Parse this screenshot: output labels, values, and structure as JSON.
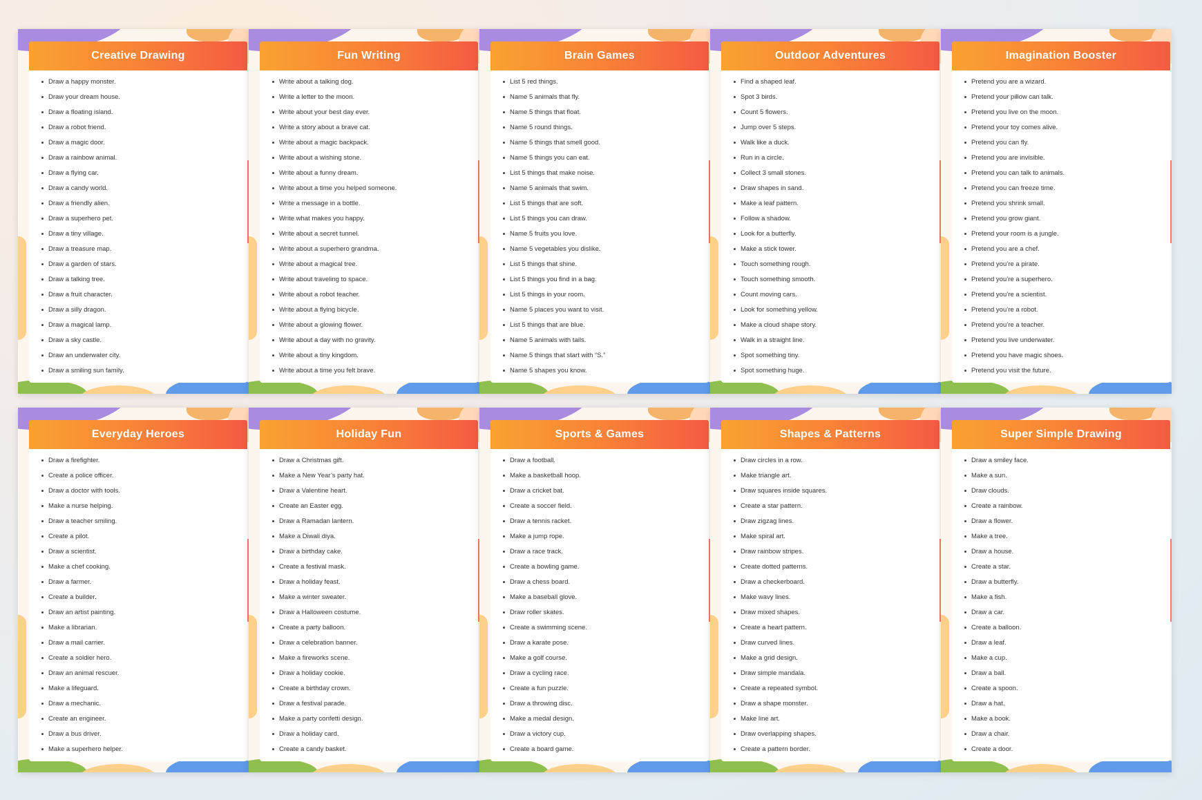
{
  "cards": [
    {
      "title": "Creative Drawing",
      "items": [
        "Draw a happy monster.",
        "Draw your dream house.",
        "Draw a floating island.",
        "Draw a robot friend.",
        "Draw a magic door.",
        "Draw a rainbow animal.",
        "Draw a flying car.",
        "Draw a candy world.",
        "Draw a friendly alien.",
        "Draw a superhero pet.",
        "Draw a tiny village.",
        "Draw a treasure map.",
        "Draw a garden of stars.",
        "Draw a talking tree.",
        "Draw a fruit character.",
        "Draw a silly dragon.",
        "Draw a magical lamp.",
        "Draw a sky castle.",
        "Draw an underwater city.",
        "Draw a smiling sun family."
      ]
    },
    {
      "title": "Fun Writing",
      "items": [
        "Write about a talking dog.",
        "Write a letter to the moon.",
        "Write about your best day ever.",
        "Write a story about a brave cat.",
        "Write about a magic backpack.",
        "Write about a wishing stone.",
        "Write about a funny dream.",
        "Write about a time you helped someone.",
        "Write a message in a bottle.",
        "Write what makes you happy.",
        "Write about a secret tunnel.",
        "Write about a superhero grandma.",
        "Write about a magical tree.",
        "Write about traveling to space.",
        "Write about a robot teacher.",
        "Write about a flying bicycle.",
        "Write about a glowing flower.",
        "Write about a day with no gravity.",
        "Write about a tiny kingdom.",
        "Write about a time you felt brave."
      ]
    },
    {
      "title": "Brain Games",
      "items": [
        "List 5 red things.",
        "Name 5 animals that fly.",
        "Name 5 things that float.",
        "Name 5 round things.",
        "Name 5 things that smell good.",
        "Name 5 things you can eat.",
        "List 5 things that make noise.",
        "Name 5 animals that swim.",
        "List 5 things that are soft.",
        "List 5 things you can draw.",
        "Name 5 fruits you love.",
        "Name 5 vegetables you dislike.",
        "List 5 things that shine.",
        "List 5 things you find in a bag.",
        "List 5 things in your room.",
        "Name 5 places you want to visit.",
        "List 5 things that are blue.",
        "Name 5 animals with tails.",
        "Name 5 things that start with “S.”",
        "Name 5 shapes you know."
      ]
    },
    {
      "title": "Outdoor Adventures",
      "items": [
        "Find a shaped leaf.",
        "Spot 3 birds.",
        "Count 5 flowers.",
        "Jump over 5 steps.",
        "Walk like a duck.",
        "Run in a circle.",
        "Collect 3 small stones.",
        "Draw shapes in sand.",
        "Make a leaf pattern.",
        "Follow a shadow.",
        "Look for a butterfly.",
        "Make a stick tower.",
        "Touch something rough.",
        "Touch something smooth.",
        "Count moving cars.",
        "Look for something yellow.",
        "Make a cloud shape story.",
        "Walk in a straight line.",
        "Spot something tiny.",
        "Spot something huge."
      ]
    },
    {
      "title": "Imagination Booster",
      "items": [
        "Pretend you are a wizard.",
        "Pretend your pillow can talk.",
        "Pretend you live on the moon.",
        "Pretend your toy comes alive.",
        "Pretend you can fly.",
        "Pretend you are invisible.",
        "Pretend you can talk to animals.",
        "Pretend you can freeze time.",
        "Pretend you shrink small.",
        "Pretend you grow giant.",
        "Pretend your room is a jungle.",
        "Pretend you are a chef.",
        "Pretend you’re a pirate.",
        "Pretend you’re a superhero.",
        "Pretend you’re a scientist.",
        "Pretend you’re a robot.",
        "Pretend you’re a teacher.",
        "Pretend you live underwater.",
        "Pretend you have magic shoes.",
        "Pretend you visit the future."
      ]
    },
    {
      "title": "Everyday Heroes",
      "items": [
        "Draw a firefighter.",
        "Create a police officer.",
        "Draw a doctor with tools.",
        "Make a nurse helping.",
        "Draw a teacher smiling.",
        "Create a pilot.",
        "Draw a scientist.",
        "Make a chef cooking.",
        "Draw a farmer.",
        "Create a builder.",
        "Draw an artist painting.",
        "Make a librarian.",
        "Draw a mail carrier.",
        "Create a soldier hero.",
        "Draw an animal rescuer.",
        "Make a lifeguard.",
        "Draw a mechanic.",
        "Create an engineer.",
        "Draw a bus driver.",
        "Make a superhero helper."
      ]
    },
    {
      "title": "Holiday Fun",
      "items": [
        "Draw a Christmas gift.",
        "Make a New Year’s party hat.",
        "Draw a Valentine heart.",
        "Create an Easter egg.",
        "Draw a Ramadan lantern.",
        "Make a Diwali diya.",
        "Draw a birthday cake.",
        "Create a festival mask.",
        "Draw a holiday feast.",
        "Make a winter sweater.",
        "Draw a Halloween costume.",
        "Create a party balloon.",
        "Draw a celebration banner.",
        "Make a fireworks scene.",
        "Draw a holiday cookie.",
        "Create a birthday crown.",
        "Draw a festival parade.",
        "Make a party confetti design.",
        "Draw a holiday card.",
        "Create a candy basket."
      ]
    },
    {
      "title": "Sports & Games",
      "items": [
        "Draw a football.",
        "Make a basketball hoop.",
        "Draw a cricket bat.",
        "Create a soccer field.",
        "Draw a tennis racket.",
        "Make a jump rope.",
        "Draw a race track.",
        "Create a bowling game.",
        "Draw a chess board.",
        "Make a baseball glove.",
        "Draw roller skates.",
        "Create a swimming scene.",
        "Draw a karate pose.",
        "Make a golf course.",
        "Draw a cycling race.",
        "Create a fun puzzle.",
        "Draw a throwing disc.",
        "Make a medal design.",
        "Draw a victory cup.",
        "Create a board game."
      ]
    },
    {
      "title": "Shapes & Patterns",
      "items": [
        "Draw circles in a row.",
        "Make triangle art.",
        "Draw squares inside squares.",
        "Create a star pattern.",
        "Draw zigzag lines.",
        "Make spiral art.",
        "Draw rainbow stripes.",
        "Create dotted patterns.",
        "Draw a checkerboard.",
        "Make wavy lines.",
        "Draw mixed shapes.",
        "Create a heart pattern.",
        "Draw curved lines.",
        "Make a grid design.",
        "Draw simple mandala.",
        "Create a repeated symbol.",
        "Draw a shape monster.",
        "Make line art.",
        "Draw overlapping shapes.",
        "Create a pattern border."
      ]
    },
    {
      "title": "Super Simple Drawing",
      "items": [
        "Draw a smiley face.",
        "Make a sun.",
        "Draw clouds.",
        "Create a rainbow.",
        "Draw a flower.",
        "Make a tree.",
        "Draw a house.",
        "Create a star.",
        "Draw a butterfly.",
        "Make a fish.",
        "Draw a car.",
        "Create a balloon.",
        "Draw a leaf.",
        "Make a cup.",
        "Draw a ball.",
        "Create a spoon.",
        "Draw a hat.",
        "Make a book.",
        "Draw a chair.",
        "Create a door."
      ]
    }
  ]
}
